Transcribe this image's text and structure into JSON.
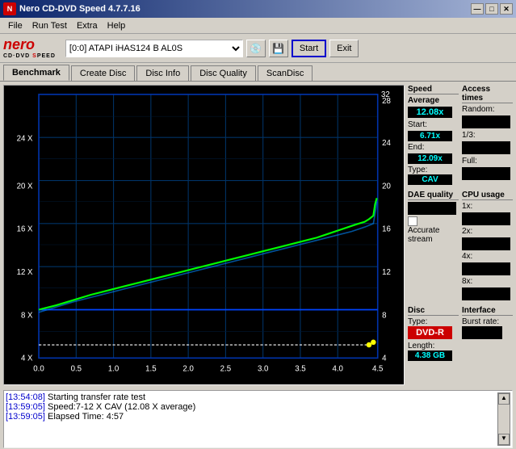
{
  "window": {
    "title": "Nero CD-DVD Speed 4.7.7.16",
    "controls": {
      "minimize": "—",
      "maximize": "□",
      "close": "✕"
    }
  },
  "menu": {
    "items": [
      "File",
      "Run Test",
      "Extra",
      "Help"
    ]
  },
  "toolbar": {
    "logo_nero": "nero",
    "logo_sub": "CD·DVD SPEED",
    "drive_label": "[0:0]  ATAPI iHAS124  B AL0S",
    "start_label": "Start",
    "exit_label": "Exit"
  },
  "tabs": [
    {
      "label": "Benchmark",
      "active": true
    },
    {
      "label": "Create Disc"
    },
    {
      "label": "Disc Info"
    },
    {
      "label": "Disc Quality",
      "active_label": true
    },
    {
      "label": "ScanDisc"
    }
  ],
  "speed": {
    "section_label": "Speed",
    "average_label": "Average",
    "average_value": "12.08x",
    "start_label": "Start:",
    "start_value": "6.71x",
    "end_label": "End:",
    "end_value": "12.09x",
    "type_label": "Type:",
    "type_value": "CAV"
  },
  "access_times": {
    "section_label": "Access times",
    "random_label": "Random:",
    "one_third_label": "1/3:",
    "full_label": "Full:"
  },
  "cpu_usage": {
    "section_label": "CPU usage",
    "x1_label": "1x:",
    "x2_label": "2x:",
    "x4_label": "4x:",
    "x8_label": "8x:"
  },
  "dae": {
    "section_label": "DAE quality",
    "accurate_label": "Accurate",
    "stream_label": "stream"
  },
  "disc": {
    "section_label": "Disc",
    "type_label": "Type:",
    "type_value": "DVD-R",
    "length_label": "Length:",
    "length_value": "4.38 GB"
  },
  "interface": {
    "section_label": "Interface",
    "burst_label": "Burst rate:"
  },
  "chart": {
    "x_labels": [
      "0.0",
      "0.5",
      "1.0",
      "1.5",
      "2.0",
      "2.5",
      "3.0",
      "3.5",
      "4.0",
      "4.5"
    ],
    "y_left_labels": [
      "4 X",
      "8 X",
      "12 X",
      "16 X",
      "20 X",
      "24 X"
    ],
    "y_right_labels": [
      "4",
      "8",
      "12",
      "16",
      "20",
      "24",
      "28",
      "32"
    ]
  },
  "log": {
    "lines": [
      {
        "timestamp": "[13:54:08]",
        "message": "Starting transfer rate test"
      },
      {
        "timestamp": "[13:59:05]",
        "message": "Speed:7-12 X CAV (12.08 X average)"
      },
      {
        "timestamp": "[13:59:05]",
        "message": "Elapsed Time: 4:57"
      }
    ]
  }
}
